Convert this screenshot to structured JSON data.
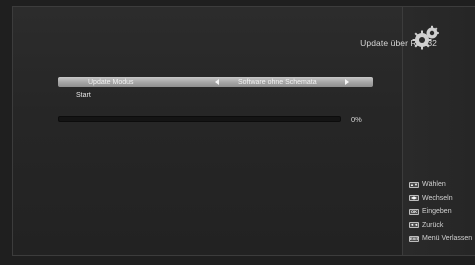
{
  "header": {
    "title": "Update über RS232"
  },
  "menu": {
    "update_modus_label": "Update Modus",
    "update_modus_value": "Software ohne Schemata",
    "start_label": "Start"
  },
  "progress": {
    "value_text": "0%",
    "fraction": 0
  },
  "legend": {
    "items": [
      {
        "key": "▲▼",
        "label": "Wählen"
      },
      {
        "key": "◀▶",
        "label": "Wechseln"
      },
      {
        "key": "OK",
        "label": "Eingeben"
      },
      {
        "key": "◄◄",
        "label": "Zurück"
      },
      {
        "key": "EXIT",
        "label": "Menü Verlassen"
      }
    ]
  },
  "colors": {
    "background": "#262626",
    "highlight": "#a8a8a8",
    "text": "#e6e6e6"
  }
}
